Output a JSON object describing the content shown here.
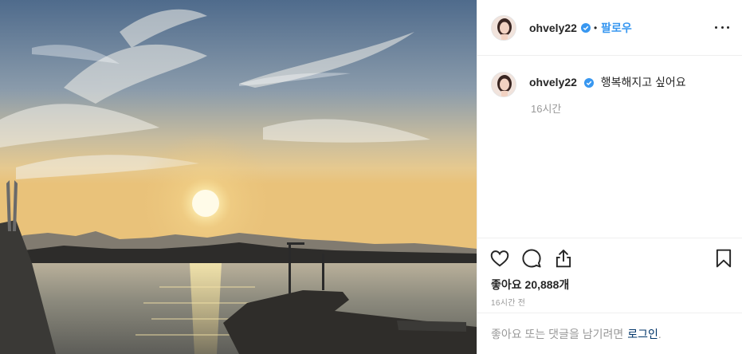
{
  "header": {
    "username": "ohvely22",
    "separator": "•",
    "follow_label": "팔로우"
  },
  "caption": {
    "username": "ohvely22",
    "text": "행복해지고 싶어요",
    "time": "16시간"
  },
  "actions": {
    "icons": [
      "heart-icon",
      "comment-icon",
      "share-icon",
      "bookmark-icon"
    ]
  },
  "likes": {
    "text": "좋아요 20,888개"
  },
  "posted": {
    "time": "16시간 전"
  },
  "comment_bar": {
    "prompt": "좋아요 또는 댓글을 남기려면",
    "login_label": "로그인",
    "end_punct": "."
  },
  "colors": {
    "accent": "#3897f0",
    "text": "#262626",
    "muted": "#999999",
    "link": "#003569",
    "verified": "#3897f0"
  }
}
